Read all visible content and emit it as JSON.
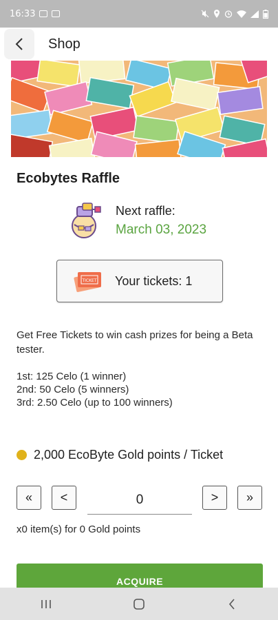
{
  "status_bar": {
    "time": "16:33"
  },
  "app_bar": {
    "title": "Shop"
  },
  "raffle": {
    "title": "Ecobytes Raffle",
    "next_label": "Next raffle:",
    "next_date": "March 03, 2023",
    "tickets_label": "Your tickets: 1",
    "description": "Get Free Tickets to win cash prizes for being a Beta tester.",
    "prizes": [
      "1st: 125 Celo (1 winner)",
      "2nd: 50 Celo (5 winners)",
      "3rd: 2.50 Celo (up to 100 winners)"
    ],
    "price_line": "2,000 EcoByte Gold points / Ticket"
  },
  "stepper": {
    "first_label": "«",
    "prev_label": "<",
    "next_label": ">",
    "last_label": "»",
    "quantity": "0"
  },
  "summary": "x0 item(s) for 0 Gold points",
  "acquire_label": "ACQUIRE",
  "colors": {
    "accent_green": "#5ea63b",
    "date_green": "#5aa440",
    "coin_gold": "#e0b21b"
  }
}
